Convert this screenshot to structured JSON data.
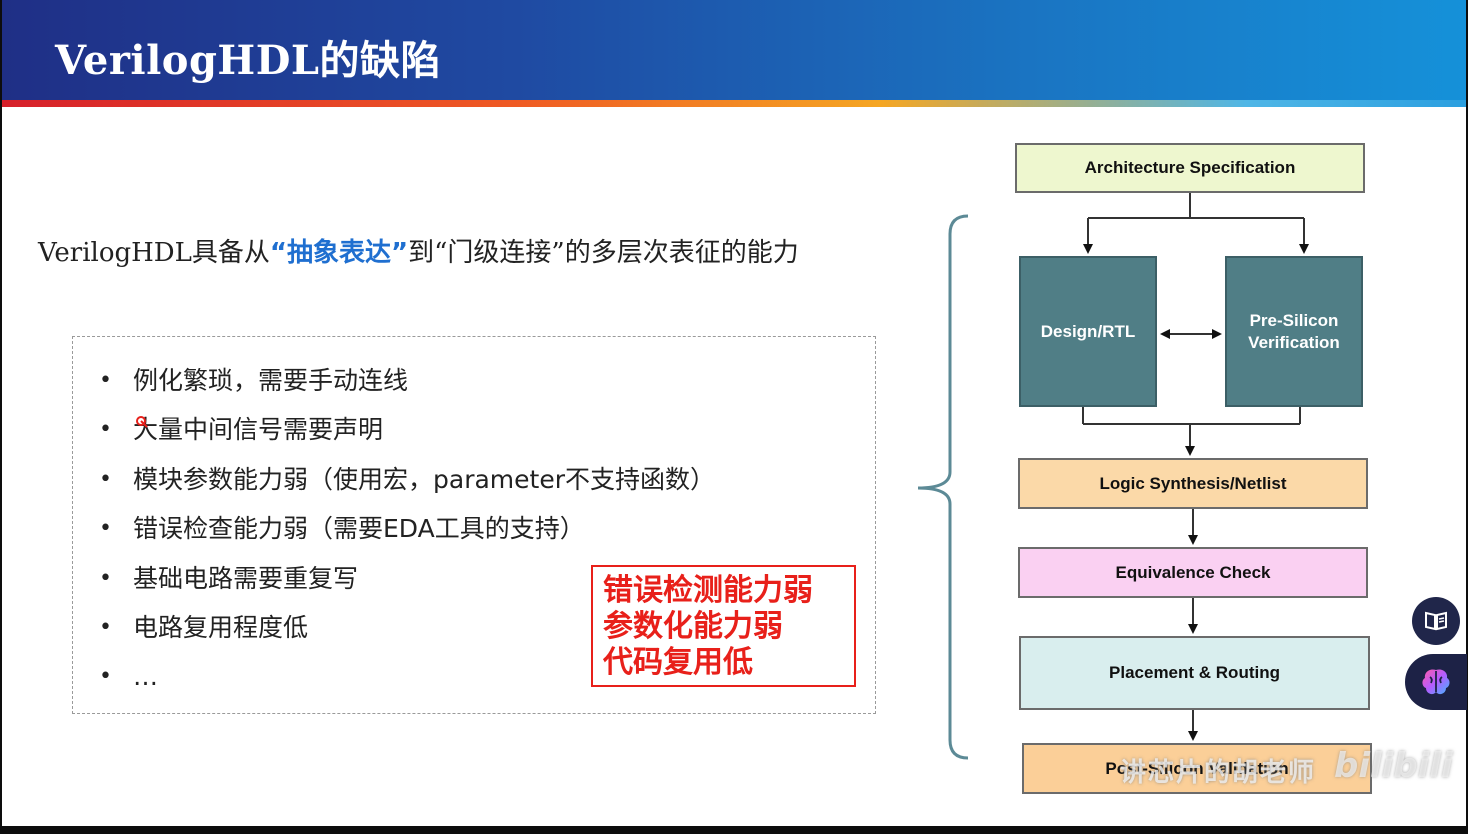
{
  "slide": {
    "title": "VerilogHDL的缺陷",
    "headline": {
      "prefix": "VerilogHDL具备从",
      "highlight": "“抽象表达”",
      "suffix": "到“门级连接”的多层次表征的能力"
    },
    "bullets": [
      "例化繁琐，需要手动连线",
      "大量中间信号需要声明",
      "模块参数能力弱（使用宏，parameter不支持函数）",
      "错误检查能力弱（需要EDA工具的支持）",
      "基础电路需要重复写",
      "电路复用程度低",
      "…"
    ],
    "bullet_symbol": "•",
    "callout": [
      "错误检测能力弱",
      "参数化能力弱",
      "代码复用低"
    ],
    "flow": {
      "architecture": "Architecture Specification",
      "design": "Design/RTL",
      "verification_line1": "Pre-Silicon",
      "verification_line2": "Verification",
      "synthesis": "Logic Synthesis/Netlist",
      "equivalence": "Equivalence Check",
      "placement": "Placement & Routing",
      "post_silicon": "Post-Silicon Validation"
    }
  },
  "overlay": {
    "watermark": "讲芯片的胡老师",
    "logo": "bilibili",
    "side_buttons": [
      "book-icon",
      "brain-icon"
    ]
  },
  "colors": {
    "title_blue": "#1f4aa2",
    "highlight_blue": "#1f6fd0",
    "callout_red": "#e8201a",
    "arch_fill": "#eef7cf",
    "teal_fill": "#507e86",
    "synthesis_fill": "#fbd9a8",
    "equivalence_fill": "#fad0f2",
    "placement_fill": "#d9eeee",
    "post_fill": "#fbcf98"
  }
}
